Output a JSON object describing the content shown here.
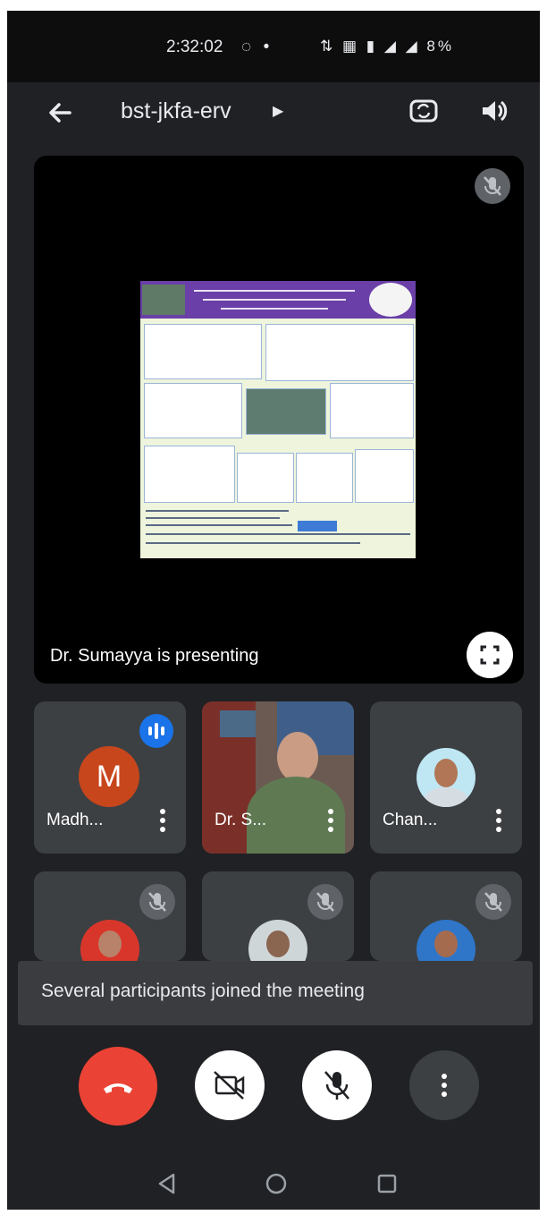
{
  "status_bar": {
    "time": "2:32:02",
    "indicators": "◌ •",
    "right": "⇅ ▦ ▮ ◢ ◢ 8%"
  },
  "top_bar": {
    "meeting_code": "bst-jkfa-erv",
    "icons": [
      "back-arrow-icon",
      "flip-camera-icon",
      "speaker-icon"
    ]
  },
  "presentation": {
    "label": "Dr. Sumayya is presenting"
  },
  "participants": [
    {
      "name": "Madh...",
      "avatar_letter": "M",
      "state": "speaking"
    },
    {
      "name": "Dr. S...",
      "state": "video"
    },
    {
      "name": "Chan...",
      "state": "photo"
    },
    {
      "name": "",
      "state": "muted"
    },
    {
      "name": "",
      "state": "muted"
    },
    {
      "name": "",
      "state": "muted"
    }
  ],
  "toast": {
    "message": "Several participants joined the meeting"
  },
  "controls": [
    "end-call-icon",
    "camera-off-icon",
    "mic-off-icon",
    "more-vert-icon"
  ],
  "colors": {
    "background": "#202124",
    "end_call": "#ea4335",
    "tile": "#3c4043",
    "speaking": "#1a73e8",
    "presentation_bg": "#000000"
  }
}
